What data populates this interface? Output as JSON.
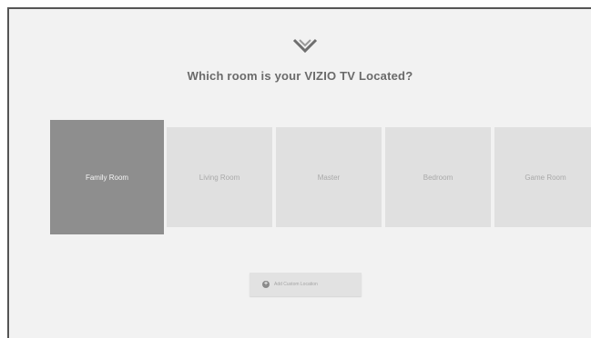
{
  "screen": {
    "title": "Which room is your VIZIO TV Located?",
    "logo_icon": "vizio-chevron-logo-icon"
  },
  "rooms": [
    {
      "label": "Family Room",
      "selected": true
    },
    {
      "label": "Living Room",
      "selected": false
    },
    {
      "label": "Master",
      "selected": false
    },
    {
      "label": "Bedroom",
      "selected": false
    },
    {
      "label": "Game Room",
      "selected": false
    }
  ],
  "add_button": {
    "label": "Add Custom Location",
    "icon": "plus-circle-icon"
  },
  "colors": {
    "background": "#f2f2f2",
    "tile": "#e0e0e0",
    "tile_selected": "#8e8e8e",
    "title_text": "#6a6a6a"
  }
}
